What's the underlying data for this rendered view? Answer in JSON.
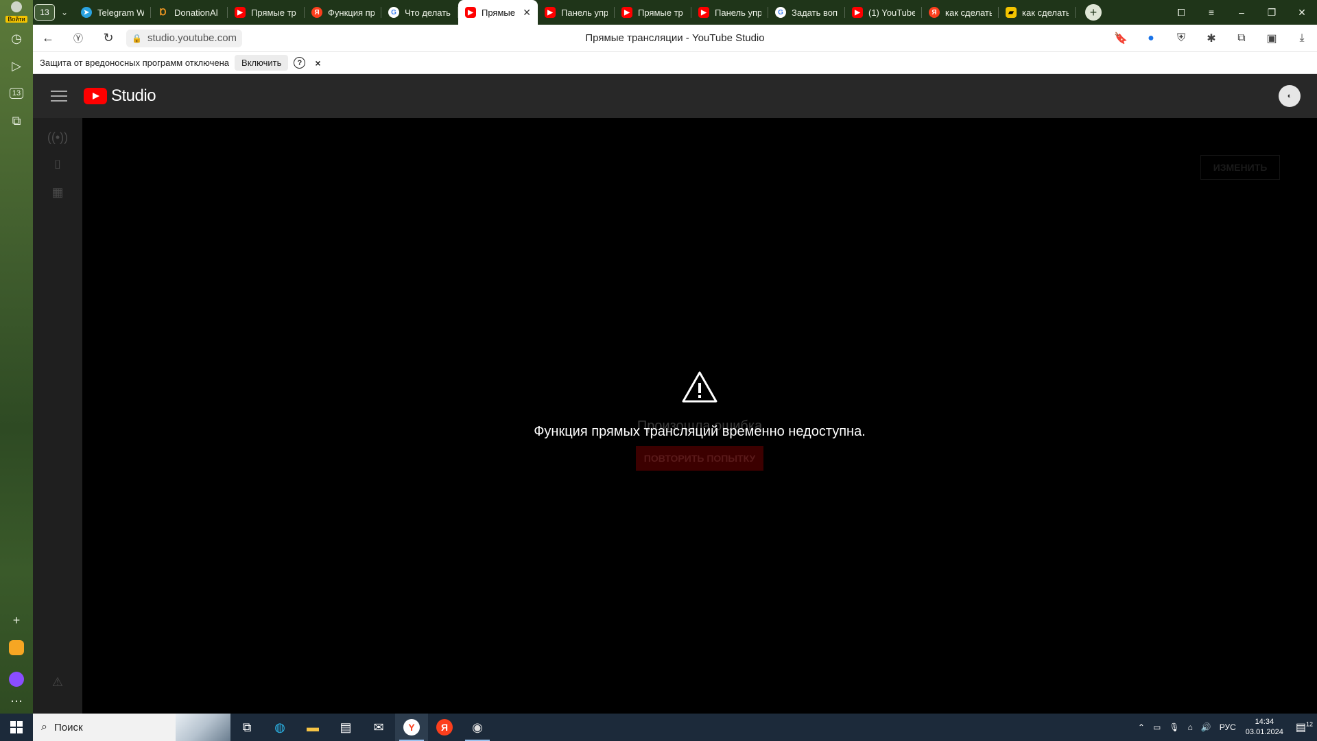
{
  "sidebar": {
    "login_label": "Войти",
    "tab_count": "13"
  },
  "tabs": [
    {
      "icon": "telegram-icon",
      "label": "Telegram W"
    },
    {
      "icon": "donationalerts-icon",
      "label": "DonationAl"
    },
    {
      "icon": "youtube-icon",
      "label": "Прямые тр"
    },
    {
      "icon": "yandex-icon",
      "label": "Функция пр"
    },
    {
      "icon": "google-icon",
      "label": "Что делать"
    },
    {
      "icon": "youtube-icon",
      "label": "Прямые",
      "active": true
    },
    {
      "icon": "youtube-icon",
      "label": "Панель упр"
    },
    {
      "icon": "youtube-icon",
      "label": "Прямые тр"
    },
    {
      "icon": "youtube-icon",
      "label": "Панель упр"
    },
    {
      "icon": "google-icon",
      "label": "Задать воп"
    },
    {
      "icon": "youtube-icon",
      "label": "(1) YouTube"
    },
    {
      "icon": "yandex-icon",
      "label": "как сделать"
    },
    {
      "icon": "image-icon",
      "label": "как сделать"
    }
  ],
  "address": {
    "url": "studio.youtube.com",
    "page_title": "Прямые трансляции - YouTube Studio"
  },
  "infobar": {
    "message": "Защита от вредоносных программ отключена",
    "enable_label": "Включить",
    "help": "?",
    "close": "×"
  },
  "studio": {
    "brand": "Studio",
    "edit_label": "ИЗМЕНИТЬ",
    "error_title": "Произошла ошибка",
    "error_message": "Функция прямых трансляций временно недоступна.",
    "retry_label": "ПОВТОРИТЬ ПОПЫТКУ"
  },
  "taskbar": {
    "search_placeholder": "Поиск",
    "language": "РУС",
    "time": "14:34",
    "date": "03.01.2024",
    "notifications": "12"
  }
}
